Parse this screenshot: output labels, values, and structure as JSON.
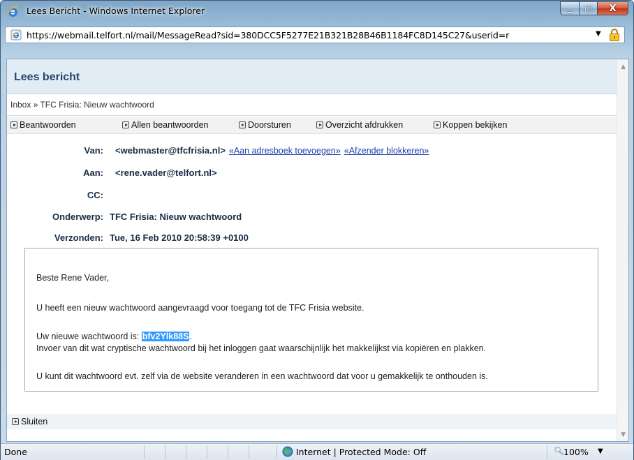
{
  "window": {
    "title": "Lees Bericht - Windows Internet Explorer",
    "minimize_glyph": "▁",
    "maximize_glyph": "□",
    "close_glyph": "X"
  },
  "address_bar": {
    "url": "https://webmail.telfort.nl/mail/MessageRead?sid=380DCC5F5277E21B321B28B46B1184FC8D145C27&userid=r",
    "dropdown_glyph": "▼"
  },
  "page": {
    "heading": "Lees bericht",
    "breadcrumb": "Inbox » TFC Frisia: Nieuw wachtwoord",
    "toolbar": [
      "Beantwoorden",
      "Allen beantwoorden",
      "Doorsturen",
      "Overzicht afdrukken",
      "Koppen bekijken"
    ],
    "headers": {
      "van_label": "Van:",
      "van_value": "<webmaster@tfcfrisia.nl>",
      "add_to_addressbook_link": "«Aan adresboek toevoegen»",
      "block_sender_link": "«Afzender blokkeren»",
      "aan_label": "Aan:",
      "aan_value": "<rene.vader@telfort.nl>",
      "cc_label": "CC:",
      "cc_value": "",
      "onderwerp_label": "Onderwerp:",
      "onderwerp_value": "TFC Frisia: Nieuw wachtwoord",
      "verzonden_label": "Verzonden:",
      "verzonden_value": "Tue, 16 Feb 2010 20:58:39 +0100"
    },
    "message": {
      "greeting": "Beste Rene Vader,",
      "line1": "U heeft een nieuw wachtwoord aangevraagd voor toegang tot de TFC Frisia website.",
      "password_prefix": "Uw nieuwe wachtwoord is: ",
      "password": "bfv2Ylk88S",
      "password_suffix": ".",
      "line3": "Invoer van dit wat cryptische wachtwoord bij het inloggen gaat waarschijnlijk het makkelijkst via kopiëren en plakken.",
      "line4": "U kunt dit wachtwoord evt. zelf via de website veranderen in een wachtwoord dat voor u gemakkelijk te onthouden is."
    },
    "close_label": "Sluiten"
  },
  "status_bar": {
    "status": "Done",
    "zone": "Internet | Protected Mode: Off",
    "zoom": "100%",
    "zoom_dropdown_glyph": "▼"
  },
  "icons": {
    "title": "ie-logo-icon",
    "address": "ie-page-icon",
    "security": "lock-icon",
    "zone": "globe-icon",
    "zoom": "magnifier-icon"
  },
  "colors": {
    "heading": "#27466e",
    "link": "#1d3fa8",
    "selection": "#3399ff",
    "header_band": "#e2ecf5"
  }
}
